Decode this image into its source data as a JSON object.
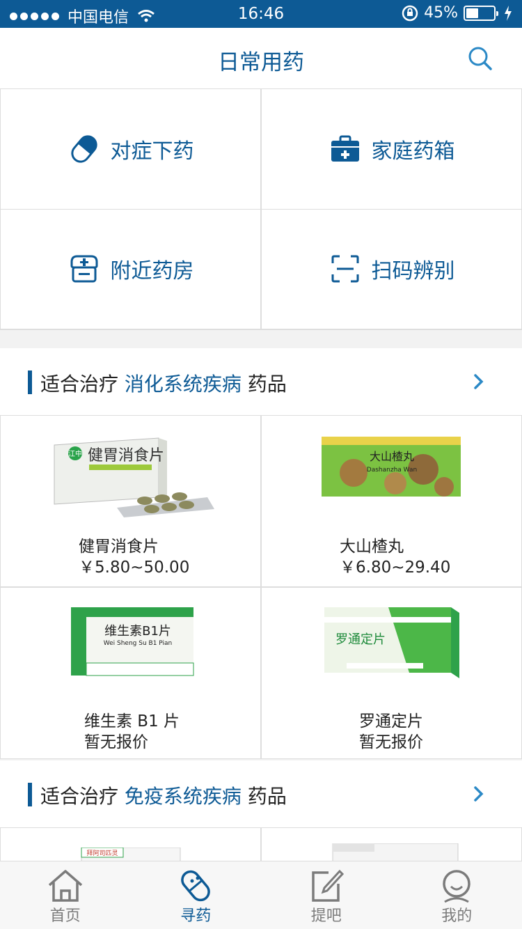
{
  "status_bar": {
    "carrier": "中国电信",
    "time": "16:46",
    "battery": "45%",
    "battery_level": 0.45
  },
  "header": {
    "title": "日常用药"
  },
  "shortcuts": [
    {
      "label": "对症下药",
      "icon": "pill-icon"
    },
    {
      "label": "家庭药箱",
      "icon": "medicine-kit-icon"
    },
    {
      "label": "附近药房",
      "icon": "pharmacy-icon"
    },
    {
      "label": "扫码辨别",
      "icon": "scan-icon"
    }
  ],
  "sections": [
    {
      "prefix": "适合治疗",
      "category": "消化系统疾病",
      "suffix": "药品",
      "products": [
        {
          "name": "健胃消食片",
          "price": "￥5.80~50.00"
        },
        {
          "name": "大山楂丸",
          "price": "￥6.80~29.40"
        },
        {
          "name": "维生素 B1 片",
          "price": "暂无报价"
        },
        {
          "name": "罗通定片",
          "price": "暂无报价"
        }
      ]
    },
    {
      "prefix": "适合治疗",
      "category": "免疫系统疾病",
      "suffix": "药品"
    }
  ],
  "product_box_text": {
    "p1": "健胃消食片",
    "p1_brand": "江中",
    "p2": "大山楂丸",
    "p2_sub": "Dashanzha Wan",
    "p3": "维生素B1片",
    "p3_sub": "Wei Sheng Su B1 Pian",
    "p4": "罗通定片",
    "p5": "拜阿司匹灵"
  },
  "tabbar": [
    {
      "label": "首页",
      "icon": "home-icon",
      "active": false
    },
    {
      "label": "寻药",
      "icon": "capsule-icon",
      "active": true
    },
    {
      "label": "提吧",
      "icon": "edit-icon",
      "active": false
    },
    {
      "label": "我的",
      "icon": "user-icon",
      "active": false
    }
  ],
  "colors": {
    "brand": "#0d5a95",
    "text": "#222222",
    "tab_inactive": "#7b7b7b"
  }
}
